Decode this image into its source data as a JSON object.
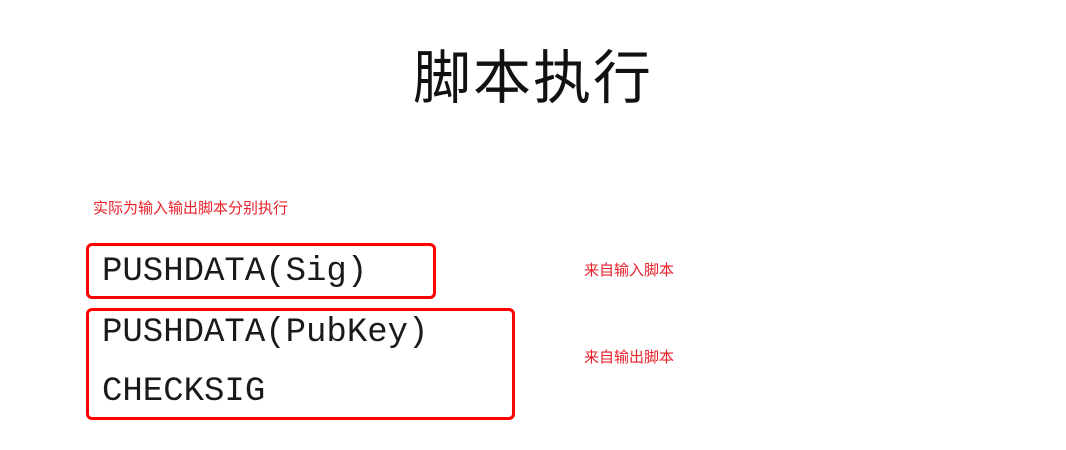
{
  "title": "脚本执行",
  "note": "实际为输入输出脚本分别执行",
  "input_script": {
    "lines": [
      "PUSHDATA(Sig)"
    ],
    "label": "来自输入脚本"
  },
  "output_script": {
    "lines": [
      "PUSHDATA(PubKey)",
      "CHECKSIG"
    ],
    "label": "来自输出脚本"
  },
  "colors": {
    "accent": "#ff0000",
    "annotation": "#e8202a",
    "text": "#1a1a1a"
  }
}
